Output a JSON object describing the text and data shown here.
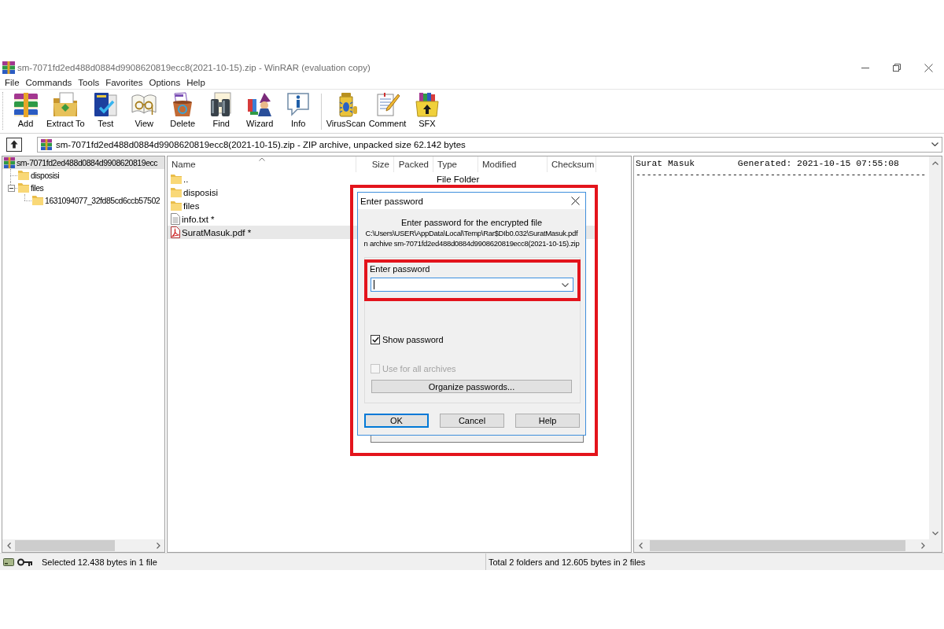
{
  "window": {
    "title": "sm-7071fd2ed488d0884d9908620819ecc8(2021-10-15).zip - WinRAR (evaluation copy)"
  },
  "menu": [
    "File",
    "Commands",
    "Tools",
    "Favorites",
    "Options",
    "Help"
  ],
  "toolbar": {
    "groups": [
      {
        "buttons": [
          {
            "label": "Add",
            "kind": "add"
          },
          {
            "label": "Extract To",
            "kind": "extract"
          },
          {
            "label": "Test",
            "kind": "test"
          },
          {
            "label": "View",
            "kind": "view"
          },
          {
            "label": "Delete",
            "kind": "delete"
          },
          {
            "label": "Find",
            "kind": "find"
          },
          {
            "label": "Wizard",
            "kind": "wizard"
          },
          {
            "label": "Info",
            "kind": "info"
          }
        ]
      },
      {
        "buttons": [
          {
            "label": "VirusScan",
            "kind": "virusscan"
          },
          {
            "label": "Comment",
            "kind": "comment"
          },
          {
            "label": "SFX",
            "kind": "sfx"
          }
        ]
      }
    ]
  },
  "address_bar": {
    "path": "sm-7071fd2ed488d0884d9908620819ecc8(2021-10-15).zip - ZIP archive, unpacked size 62.142 bytes"
  },
  "tree": {
    "items": [
      {
        "label": "sm-7071fd2ed488d0884d9908620819ecc",
        "kind": "archive",
        "selected": true,
        "children": [
          {
            "label": "disposisi",
            "kind": "folder",
            "selected": false
          },
          {
            "label": "files",
            "kind": "folder",
            "selected": false,
            "expanded": true,
            "children": [
              {
                "label": "1631094077_32fd85cd6ccb57502",
                "kind": "folder",
                "selected": false
              }
            ]
          }
        ]
      }
    ]
  },
  "file_list": {
    "columns": [
      {
        "label": "Name",
        "sorted": true
      },
      {
        "label": "Size",
        "sorted": false
      },
      {
        "label": "Packed",
        "sorted": false
      },
      {
        "label": "Type",
        "sorted": false
      },
      {
        "label": "Modified",
        "sorted": false
      },
      {
        "label": "Checksum",
        "sorted": false
      }
    ],
    "rows": [
      {
        "name": "..",
        "kind": "folder",
        "type": "File Folder",
        "selected": false
      },
      {
        "name": "disposisi",
        "kind": "folder",
        "selected": false
      },
      {
        "name": "files",
        "kind": "folder",
        "selected": false
      },
      {
        "name": "info.txt *",
        "kind": "text",
        "selected": false
      },
      {
        "name": "SuratMasuk.pdf *",
        "kind": "pdf",
        "selected": true
      }
    ]
  },
  "comment_panel": {
    "lines": [
      "Surat Masuk        Generated: 2021-10-15 07:55:08",
      "------------------------------------------------------"
    ]
  },
  "status_bar": {
    "left": "Selected 12.438 bytes in 1 file",
    "right": "Total 2 folders and 12.605 bytes in 2 files"
  },
  "dialog": {
    "title": "Enter password",
    "highlighted": true,
    "message": "Enter password for the encrypted file",
    "path_lines": [
      "C:\\Users\\USER\\AppData\\Local\\Temp\\Rar$DIb0.032\\SuratMasuk.pdf",
      "n archive sm-7071fd2ed488d0884d9908620819ecc8(2021-10-15).zip"
    ],
    "password_field": {
      "label": "Enter password",
      "highlighted": true,
      "focused": true
    },
    "options": [
      {
        "label": "Show password",
        "checked": true,
        "disabled": false
      },
      {
        "label": "Use for all archives",
        "checked": false,
        "disabled": true
      }
    ],
    "organize_button": "Organize passwords...",
    "buttons": [
      {
        "label": "OK",
        "default": true
      },
      {
        "label": "Cancel",
        "default": false
      },
      {
        "label": "Help",
        "default": false
      }
    ]
  }
}
